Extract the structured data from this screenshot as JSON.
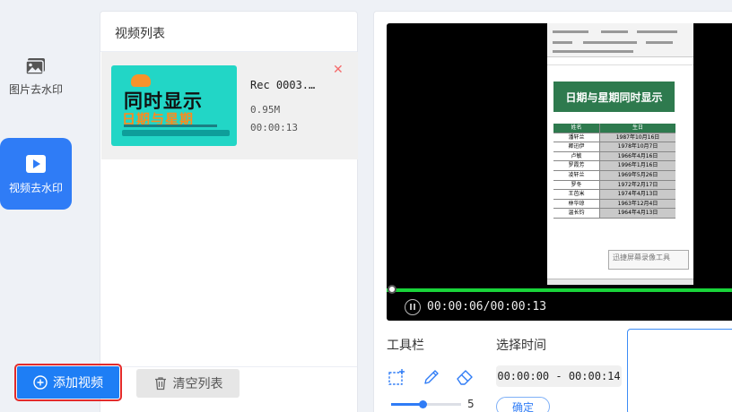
{
  "nav": {
    "items": [
      {
        "label": "图片去水印",
        "icon": "image-icon"
      },
      {
        "label": "视频去水印",
        "icon": "video-icon",
        "active": true
      }
    ]
  },
  "video_list": {
    "title": "视频列表",
    "items": [
      {
        "name": "Rec 0003.…",
        "size": "0.95M",
        "duration": "00:00:13",
        "thumb_title": "同时显示",
        "thumb_subtitle": "日期与星期"
      }
    ],
    "add_label": "添加视频",
    "clear_label": "清空列表"
  },
  "player": {
    "time": "00:00:06/00:00:13",
    "progress": 0.46,
    "sheet_banner": "日期与星期同时显示",
    "sheet_headers": [
      "姓名",
      "生日"
    ],
    "sheet_rows": [
      [
        "潘轩兰",
        "1987年10月16日"
      ],
      [
        "卿迅伊",
        "1978年10月7日"
      ],
      [
        "卢敏",
        "1966年4月16日"
      ],
      [
        "罗霞芳",
        "1996年1月16日"
      ],
      [
        "凌轩兰",
        "1969年5月26日"
      ],
      [
        "罗冬",
        "1972年2月17日"
      ],
      [
        "王芭米",
        "1974年4月13日"
      ],
      [
        "林华琼",
        "1963年12月4日"
      ],
      [
        "温长钧",
        "1964年4月13日"
      ]
    ],
    "watermark": "迅捷屏幕录像工具"
  },
  "tools": {
    "title": "工具栏",
    "brush_size": "5",
    "brush_fraction": 0.45
  },
  "time_select": {
    "title": "选择时间",
    "range": "00:00:00 - 00:00:14",
    "confirm_label": "确定"
  },
  "colors": {
    "accent": "#2f7cf6",
    "danger": "#e32b2b",
    "progress": "#19d43a",
    "sheet_green": "#2e7a4e"
  }
}
